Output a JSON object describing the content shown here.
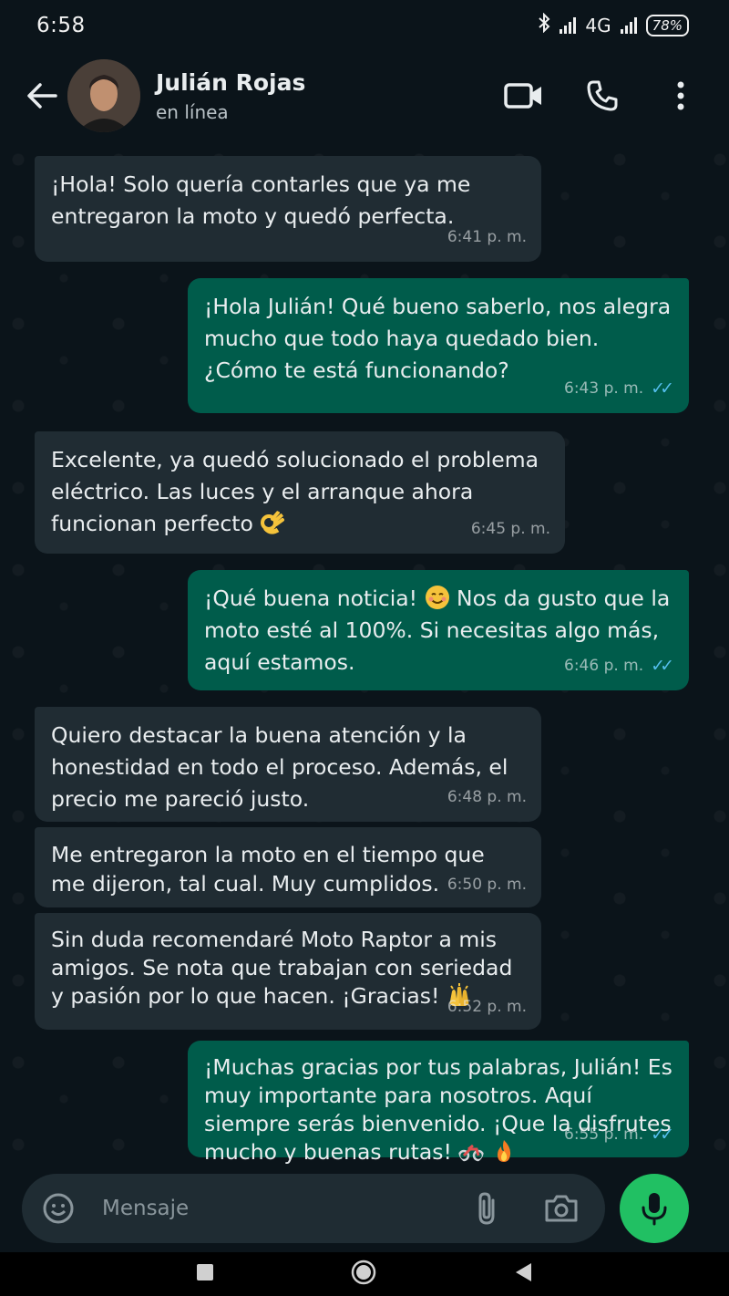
{
  "status_bar": {
    "time": "6:58",
    "network": "4G",
    "battery": "78%"
  },
  "header": {
    "contact_name": "Julián Rojas",
    "contact_status": "en línea"
  },
  "messages": [
    {
      "dir": "in",
      "text": "¡Hola! Solo quería contarles que ya me entregaron la moto y quedó perfecta.",
      "time": "6:41 p. m."
    },
    {
      "dir": "out",
      "text": "¡Hola Julián! Qué bueno saberlo, nos alegra mucho que todo haya quedado bien. ¿Cómo te está funcionando?",
      "time": "6:43 p. m.",
      "read": true
    },
    {
      "dir": "in",
      "text": "Excelente, ya quedó solucionado el problema eléctrico. Las luces y el arranque ahora funcionan perfecto",
      "emoji": "ok-hand",
      "time": "6:45 p. m."
    },
    {
      "dir": "out",
      "text_a": "¡Qué buena noticia!",
      "emoji": "smiling-face",
      "text_b": "Nos da gusto que la moto esté al 100%. Si necesitas algo más, aquí estamos.",
      "time": "6:46 p. m.",
      "read": true
    },
    {
      "dir": "in",
      "text": "Quiero destacar la buena atención y la honestidad en todo el proceso. Además, el precio me pareció justo.",
      "time": "6:48 p. m."
    },
    {
      "dir": "in",
      "text": "Me entregaron la moto en el tiempo que me dijeron, tal cual. Muy cumplidos.",
      "time": "6:50 p. m."
    },
    {
      "dir": "in",
      "text": "Sin duda recomendaré Moto Raptor a mis amigos. Se nota que trabajan con seriedad y pasión por lo que hacen. ¡Gracias!",
      "emoji": "raised-hands",
      "time": "6:52 p. m."
    },
    {
      "dir": "out",
      "text": "¡Muchas gracias por tus palabras, Julián! Es muy importante para nosotros. Aquí siempre serás bienvenido. ¡Que la disfrutes mucho y buenas rutas!",
      "emoji": "motorcycle-fire",
      "time": "6:55 p. m.",
      "read": true
    }
  ],
  "composer": {
    "placeholder": "Mensaje"
  },
  "colors": {
    "incoming": "#202c33",
    "outgoing": "#005c4b",
    "mic": "#21c063",
    "read_ticks": "#53bdeb"
  }
}
